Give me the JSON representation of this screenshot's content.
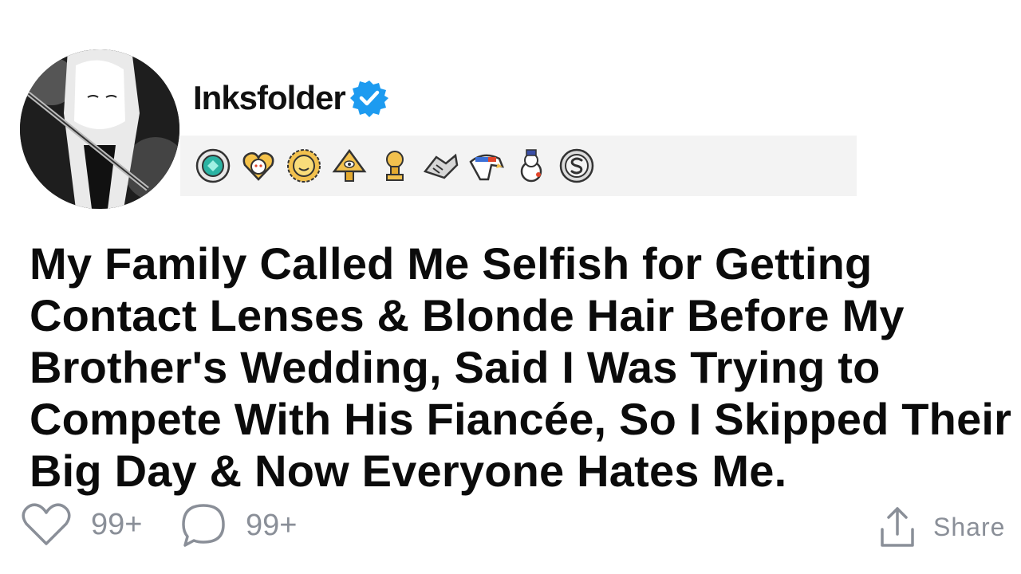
{
  "user": {
    "name": "Inksfolder",
    "verified_icon": "verified-badge-icon",
    "verified_color": "#1d9bf0"
  },
  "awards": [
    {
      "icon": "diamond-gem-award-icon"
    },
    {
      "icon": "wholesome-heart-award-icon"
    },
    {
      "icon": "sun-face-award-icon"
    },
    {
      "icon": "pyramid-eye-award-icon"
    },
    {
      "icon": "gold-trophy-award-icon"
    },
    {
      "icon": "handshake-award-icon"
    },
    {
      "icon": "eagle-award-icon"
    },
    {
      "icon": "snowman-award-icon"
    },
    {
      "icon": "silver-s-award-icon"
    }
  ],
  "post": {
    "title": "My Family Called Me Selfish for Getting Contact Lenses & Blonde Hair Before My Brother's Wedding, Said I Was Trying to Compete With His Fiancée, So I Skipped Their Big Day & Now Everyone Hates Me."
  },
  "actions": {
    "like_count": "99+",
    "comment_count": "99+",
    "share_label": "Share"
  },
  "colors": {
    "meta_gray": "#8a8f98",
    "award_bar_bg": "#f3f3f3",
    "title": "#0b0b0b"
  }
}
